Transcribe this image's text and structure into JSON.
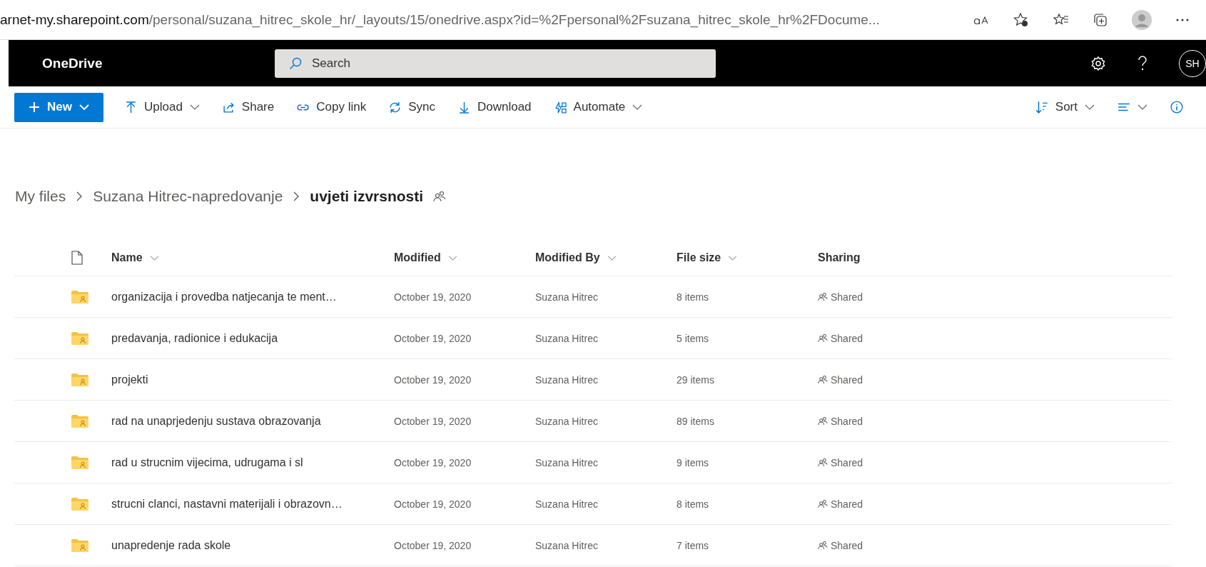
{
  "browser": {
    "url_host": "arnet-my.sharepoint.com",
    "url_path": "/personal/suzana_hitrec_skole_hr/_layouts/15/onedrive.aspx?id=%2Fpersonal%2Fsuzana_hitrec_skole_hr%2FDocume..."
  },
  "app_bar": {
    "title": "OneDrive",
    "search": {
      "placeholder": "Search"
    },
    "avatar": "SH"
  },
  "commands": [
    {
      "label": "New",
      "kind": "primary",
      "caret": true
    },
    {
      "label": "Upload",
      "kind": "upload",
      "caret": true
    },
    {
      "label": "Share",
      "kind": "share",
      "caret": false
    },
    {
      "label": "Copy link",
      "kind": "link",
      "caret": false
    },
    {
      "label": "Sync",
      "kind": "sync",
      "caret": false
    },
    {
      "label": "Download",
      "kind": "download",
      "caret": false
    },
    {
      "label": "Automate",
      "kind": "automate",
      "caret": true
    }
  ],
  "right_commands": [
    {
      "label": "Sort",
      "kind": "sort",
      "caret": true
    },
    {
      "kind": "view",
      "caret": true
    },
    {
      "kind": "info",
      "caret": false
    }
  ],
  "breadcrumb": [
    {
      "label": "My files",
      "current": false
    },
    {
      "label": "Suzana Hitrec-napredovanje",
      "current": false
    },
    {
      "label": "uvjeti izvrsnosti",
      "current": true
    }
  ],
  "table": {
    "columns": [
      {
        "label": "Name",
        "sortable": true
      },
      {
        "label": "Modified",
        "sortable": true
      },
      {
        "label": "Modified By",
        "sortable": true
      },
      {
        "label": "File size",
        "sortable": true
      },
      {
        "label": "Sharing",
        "sortable": false
      }
    ],
    "rows": [
      {
        "name": "organizacija i provedba natjecanja te ment…",
        "modified": "October 19, 2020",
        "modified_by": "Suzana Hitrec",
        "size": "8 items",
        "sharing": "Shared"
      },
      {
        "name": "predavanja, radionice i edukacija",
        "modified": "October 19, 2020",
        "modified_by": "Suzana Hitrec",
        "size": "5 items",
        "sharing": "Shared"
      },
      {
        "name": "projekti",
        "modified": "October 19, 2020",
        "modified_by": "Suzana Hitrec",
        "size": "29 items",
        "sharing": "Shared"
      },
      {
        "name": "rad na unaprjedenju sustava obrazovanja",
        "modified": "October 19, 2020",
        "modified_by": "Suzana Hitrec",
        "size": "89 items",
        "sharing": "Shared"
      },
      {
        "name": "rad u strucnim vijecima, udrugama i sl",
        "modified": "October 19, 2020",
        "modified_by": "Suzana Hitrec",
        "size": "9 items",
        "sharing": "Shared"
      },
      {
        "name": "strucni clanci, nastavni materijali i obrazovn…",
        "modified": "October 19, 2020",
        "modified_by": "Suzana Hitrec",
        "size": "8 items",
        "sharing": "Shared"
      },
      {
        "name": "unapredenje rada skole",
        "modified": "October 19, 2020",
        "modified_by": "Suzana Hitrec",
        "size": "7 items",
        "sharing": "Shared"
      }
    ]
  }
}
